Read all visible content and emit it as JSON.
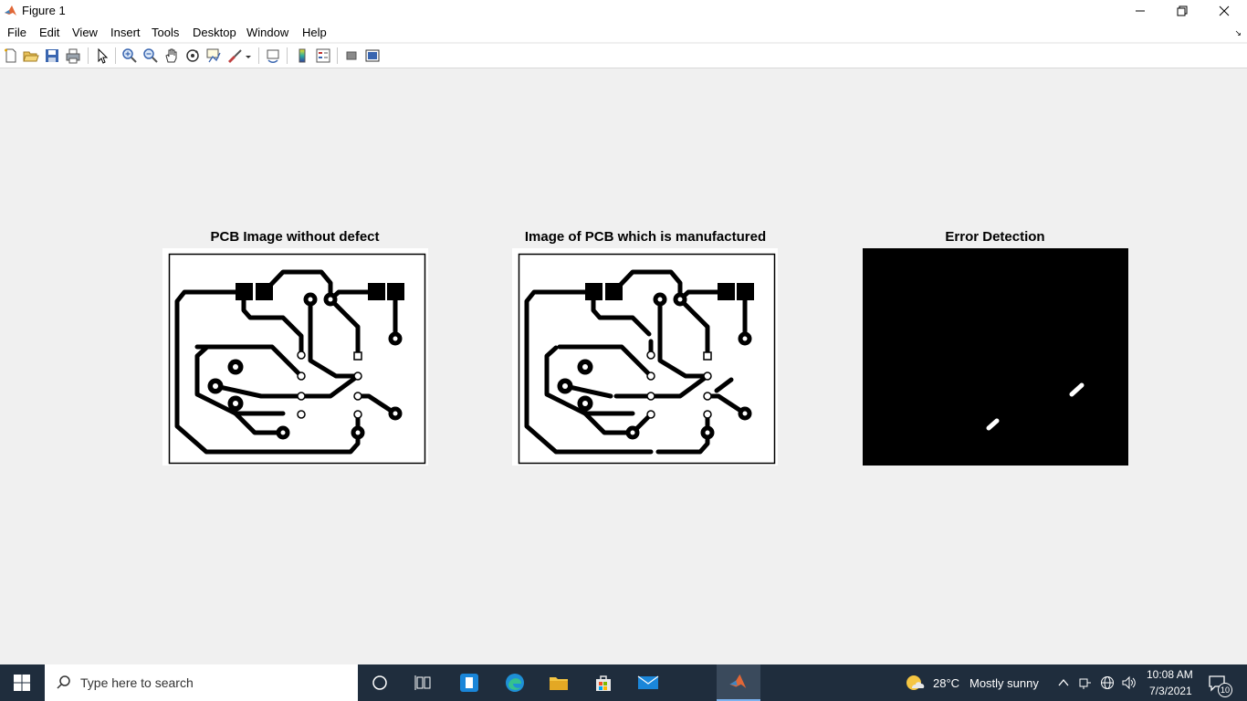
{
  "window": {
    "title": "Figure 1"
  },
  "menu": [
    "File",
    "Edit",
    "View",
    "Insert",
    "Tools",
    "Desktop",
    "Window",
    "Help"
  ],
  "toolbar_icons": [
    "new-figure-icon",
    "open-file-icon",
    "save-icon",
    "print-icon",
    "select-arrow-icon",
    "zoom-in-icon",
    "zoom-out-icon",
    "pan-hand-icon",
    "rotate-3d-icon",
    "data-cursor-icon",
    "brush-icon",
    "link-plot-icon",
    "colorbar-icon",
    "legend-icon",
    "hide-plot-tools-icon",
    "show-plot-tools-icon"
  ],
  "axes": [
    {
      "title": "PCB Image without defect"
    },
    {
      "title": "Image of PCB which is manufactured"
    },
    {
      "title": "Error Detection"
    }
  ],
  "taskbar": {
    "search_placeholder": "Type here to search",
    "weather_temp": "28°C",
    "weather_text": "Mostly sunny",
    "time": "10:08 AM",
    "date": "7/3/2021",
    "notifications": "10"
  },
  "colors": {
    "taskbar": "#1f2d3d",
    "figure_bg": "#f0f0f0"
  }
}
